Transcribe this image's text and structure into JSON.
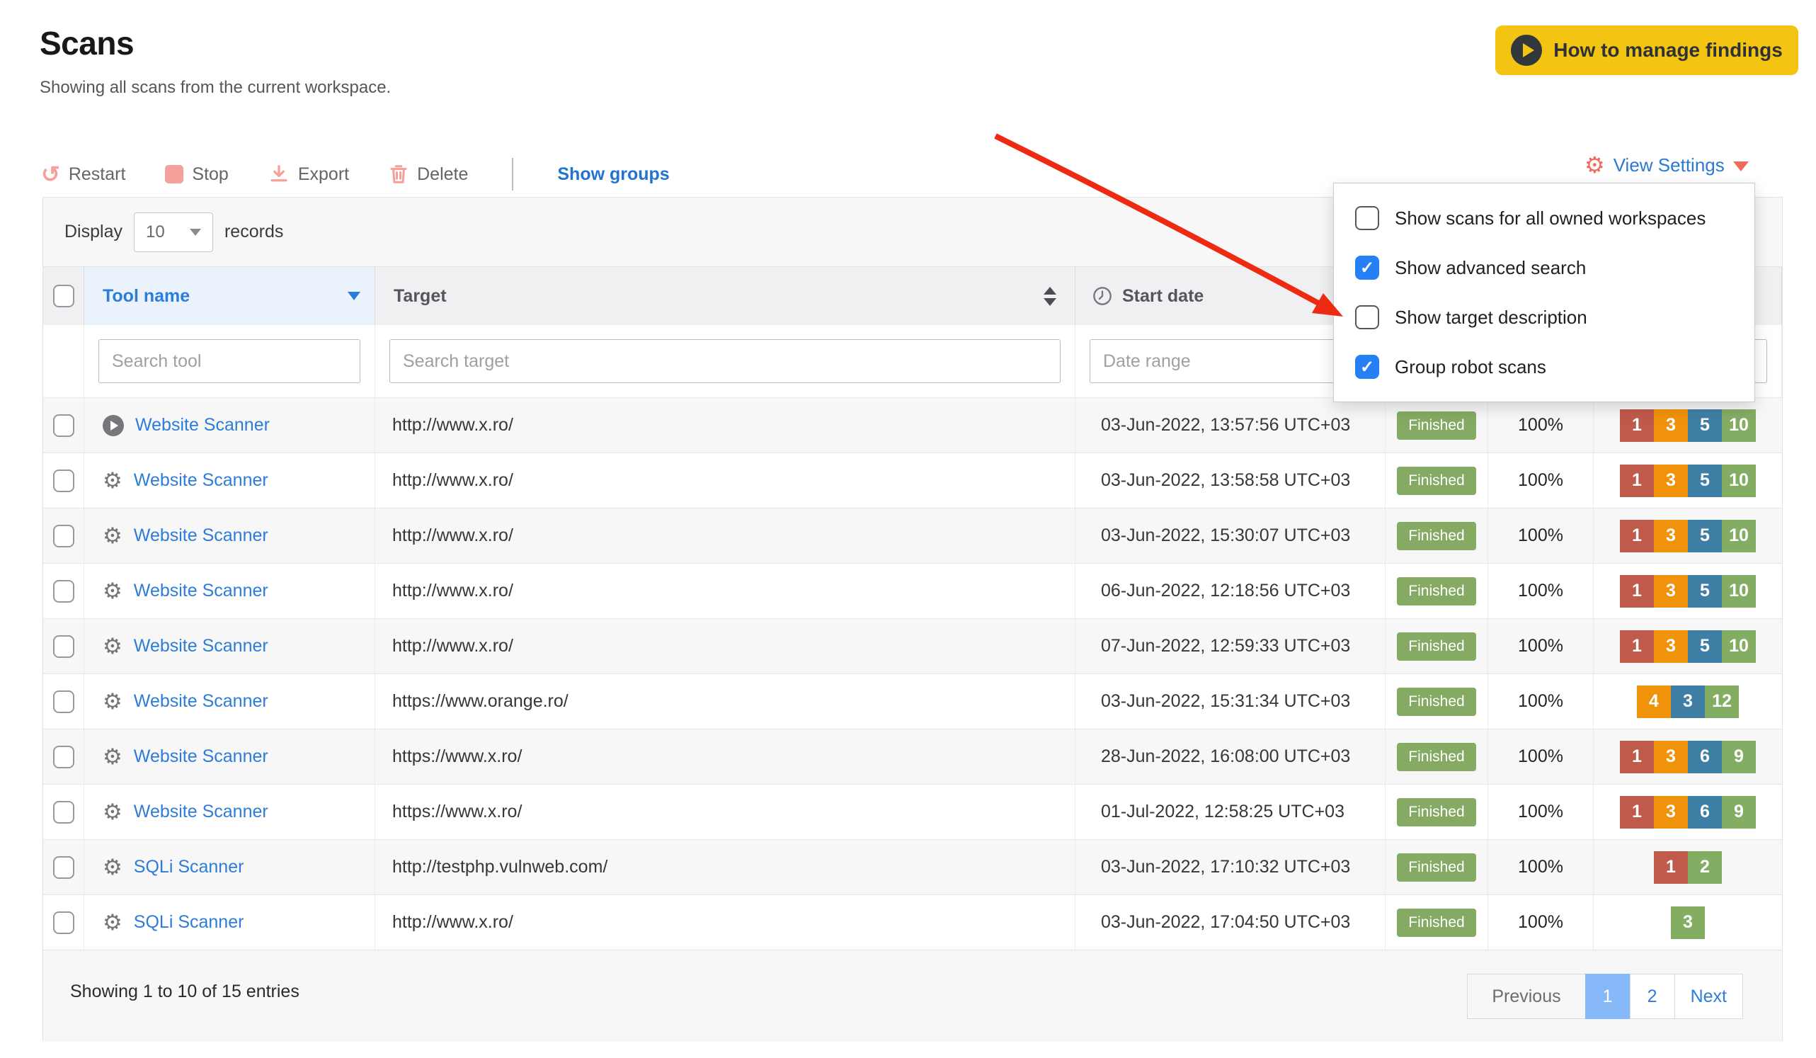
{
  "page": {
    "title": "Scans",
    "subtitle": "Showing all scans from the current workspace."
  },
  "header_actions": {
    "how_to_label": "How to manage findings",
    "how_to_icon": "play-circle-icon"
  },
  "toolbar": {
    "actions": [
      {
        "label": "Restart",
        "icon": "restart-icon"
      },
      {
        "label": "Stop",
        "icon": "stop-icon"
      },
      {
        "label": "Export",
        "icon": "export-download-icon"
      },
      {
        "label": "Delete",
        "icon": "trash-icon"
      }
    ],
    "show_groups_label": "Show groups",
    "view_settings_label": "View Settings",
    "view_settings_icon": "gear-icon"
  },
  "display": {
    "label_before": "Display",
    "value": "10",
    "label_after": "records"
  },
  "table": {
    "columns": {
      "tool": "Tool name",
      "target": "Target",
      "start_date": "Start date",
      "start_date_icon": "clock-icon",
      "tool_sort": "descending",
      "target_sort_icon": "sort-both-icon"
    },
    "filters": {
      "tool_placeholder": "Search tool",
      "target_placeholder": "Search target",
      "date_placeholder": "Date range"
    },
    "rows": [
      {
        "icon": "play",
        "tool": "Website Scanner",
        "target": "http://www.x.ro/",
        "date": "03-Jun-2022, 13:57:56 UTC+03",
        "status": "Finished",
        "progress": "100%",
        "findings": [
          {
            "severity": "high",
            "count": "1"
          },
          {
            "severity": "medium",
            "count": "3"
          },
          {
            "severity": "low",
            "count": "5"
          },
          {
            "severity": "info",
            "count": "10"
          }
        ]
      },
      {
        "icon": "gear",
        "tool": "Website Scanner",
        "target": "http://www.x.ro/",
        "date": "03-Jun-2022, 13:58:58 UTC+03",
        "status": "Finished",
        "progress": "100%",
        "findings": [
          {
            "severity": "high",
            "count": "1"
          },
          {
            "severity": "medium",
            "count": "3"
          },
          {
            "severity": "low",
            "count": "5"
          },
          {
            "severity": "info",
            "count": "10"
          }
        ]
      },
      {
        "icon": "gear",
        "tool": "Website Scanner",
        "target": "http://www.x.ro/",
        "date": "03-Jun-2022, 15:30:07 UTC+03",
        "status": "Finished",
        "progress": "100%",
        "findings": [
          {
            "severity": "high",
            "count": "1"
          },
          {
            "severity": "medium",
            "count": "3"
          },
          {
            "severity": "low",
            "count": "5"
          },
          {
            "severity": "info",
            "count": "10"
          }
        ]
      },
      {
        "icon": "gear",
        "tool": "Website Scanner",
        "target": "http://www.x.ro/",
        "date": "06-Jun-2022, 12:18:56 UTC+03",
        "status": "Finished",
        "progress": "100%",
        "findings": [
          {
            "severity": "high",
            "count": "1"
          },
          {
            "severity": "medium",
            "count": "3"
          },
          {
            "severity": "low",
            "count": "5"
          },
          {
            "severity": "info",
            "count": "10"
          }
        ]
      },
      {
        "icon": "gear",
        "tool": "Website Scanner",
        "target": "http://www.x.ro/",
        "date": "07-Jun-2022, 12:59:33 UTC+03",
        "status": "Finished",
        "progress": "100%",
        "findings": [
          {
            "severity": "high",
            "count": "1"
          },
          {
            "severity": "medium",
            "count": "3"
          },
          {
            "severity": "low",
            "count": "5"
          },
          {
            "severity": "info",
            "count": "10"
          }
        ]
      },
      {
        "icon": "gear",
        "tool": "Website Scanner",
        "target": "https://www.orange.ro/",
        "date": "03-Jun-2022, 15:31:34 UTC+03",
        "status": "Finished",
        "progress": "100%",
        "findings": [
          {
            "severity": "medium",
            "count": "4"
          },
          {
            "severity": "low",
            "count": "3"
          },
          {
            "severity": "info",
            "count": "12"
          }
        ]
      },
      {
        "icon": "gear",
        "tool": "Website Scanner",
        "target": "https://www.x.ro/",
        "date": "28-Jun-2022, 16:08:00 UTC+03",
        "status": "Finished",
        "progress": "100%",
        "findings": [
          {
            "severity": "high",
            "count": "1"
          },
          {
            "severity": "medium",
            "count": "3"
          },
          {
            "severity": "low",
            "count": "6"
          },
          {
            "severity": "info",
            "count": "9"
          }
        ]
      },
      {
        "icon": "gear",
        "tool": "Website Scanner",
        "target": "https://www.x.ro/",
        "date": "01-Jul-2022, 12:58:25 UTC+03",
        "status": "Finished",
        "progress": "100%",
        "findings": [
          {
            "severity": "high",
            "count": "1"
          },
          {
            "severity": "medium",
            "count": "3"
          },
          {
            "severity": "low",
            "count": "6"
          },
          {
            "severity": "info",
            "count": "9"
          }
        ]
      },
      {
        "icon": "gear",
        "tool": "SQLi Scanner",
        "target": "http://testphp.vulnweb.com/",
        "date": "03-Jun-2022, 17:10:32 UTC+03",
        "status": "Finished",
        "progress": "100%",
        "findings": [
          {
            "severity": "high",
            "count": "1"
          },
          {
            "severity": "info",
            "count": "2"
          }
        ]
      },
      {
        "icon": "gear",
        "tool": "SQLi Scanner",
        "target": "http://www.x.ro/",
        "date": "03-Jun-2022, 17:04:50 UTC+03",
        "status": "Finished",
        "progress": "100%",
        "findings": [
          {
            "severity": "info",
            "count": "3"
          }
        ]
      }
    ],
    "footer": {
      "summary": "Showing 1 to 10 of 15 entries",
      "pagination": [
        {
          "label": "Previous",
          "muted": true
        },
        {
          "label": "1",
          "active": true
        },
        {
          "label": "2"
        },
        {
          "label": "Next"
        }
      ]
    }
  },
  "view_settings_menu": {
    "items": [
      {
        "label": "Show scans for all owned workspaces",
        "checked": false
      },
      {
        "label": "Show advanced search",
        "checked": true
      },
      {
        "label": "Show target description",
        "checked": false
      },
      {
        "label": "Group robot scans",
        "checked": true
      }
    ]
  },
  "colors": {
    "accent_blue": "#2d7dd9",
    "coral": "#f26a5a",
    "salmon": "#f6a09a",
    "yellow": "#f3c512",
    "arrow_red": "#ee2b12",
    "checkbox_blue": "#2580f5",
    "badge_green": "#84aa63",
    "pagination_active": "#87b8f8",
    "severity": {
      "high": "#c05b4b",
      "medium": "#f0930b",
      "low": "#3f7fa6",
      "info": "#84ad64"
    }
  }
}
